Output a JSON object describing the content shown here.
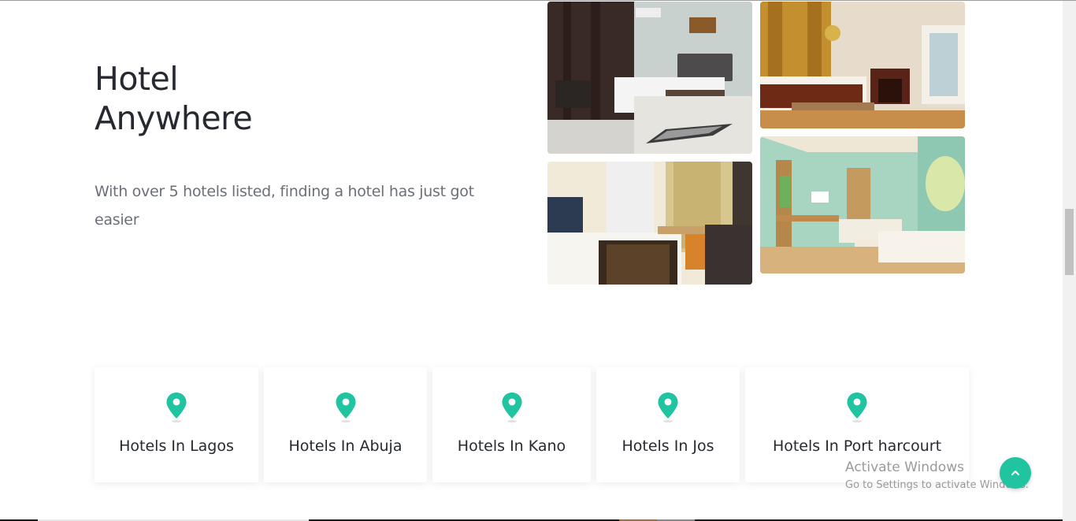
{
  "hero": {
    "title_line1": "Hotel",
    "title_line2": "Anywhere",
    "subtitle": "With over 5 hotels listed, finding a hotel has just got easier"
  },
  "gallery": [
    {
      "name": "hotel-room-photo-1"
    },
    {
      "name": "hotel-room-photo-2"
    },
    {
      "name": "hotel-room-photo-3"
    },
    {
      "name": "hotel-room-photo-4"
    }
  ],
  "cities": [
    {
      "label": "Hotels In Lagos",
      "icon": "map-pin-icon"
    },
    {
      "label": "Hotels In Abuja",
      "icon": "map-pin-icon"
    },
    {
      "label": "Hotels In Kano",
      "icon": "map-pin-icon"
    },
    {
      "label": "Hotels In Jos",
      "icon": "map-pin-icon"
    },
    {
      "label": "Hotels In Port harcourt",
      "icon": "map-pin-icon"
    }
  ],
  "back_to_top": {
    "icon": "chevron-up-icon"
  },
  "watermark": {
    "title": "Activate Windows",
    "subtitle": "Go to Settings to activate Windows."
  },
  "colors": {
    "accent": "#21c4a0",
    "heading": "#26292f",
    "body_text": "#6b6f77"
  }
}
